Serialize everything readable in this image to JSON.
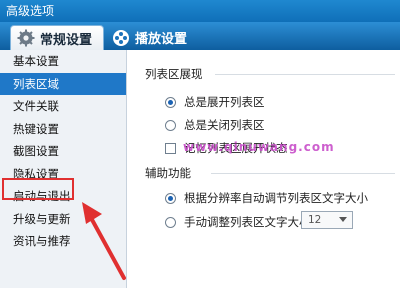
{
  "window": {
    "title": "高级选项"
  },
  "tabs": [
    {
      "label": "常规设置",
      "icon": "gear-icon",
      "active": true
    },
    {
      "label": "播放设置",
      "icon": "film-reel-icon",
      "active": false
    }
  ],
  "sidebar": {
    "items": [
      {
        "label": "基本设置"
      },
      {
        "label": "列表区域"
      },
      {
        "label": "文件关联"
      },
      {
        "label": "热键设置"
      },
      {
        "label": "截图设置"
      },
      {
        "label": "隐私设置"
      },
      {
        "label": "启动与退出"
      },
      {
        "label": "升级与更新"
      },
      {
        "label": "资讯与推荐"
      }
    ],
    "selected_index": 1,
    "highlighted_index": 6
  },
  "panel": {
    "expand_group": {
      "title": "列表区展现",
      "options": [
        {
          "label": "总是展开列表区",
          "checked": true
        },
        {
          "label": "总是关闭列表区",
          "checked": false
        },
        {
          "label": "记忆列表区展开状态",
          "checked": false
        }
      ]
    },
    "assist_group": {
      "title": "辅助功能",
      "options": [
        {
          "label": "根据分辨率自动调节列表区文字大小",
          "checked": true
        },
        {
          "label": "手动调整列表区文字大小",
          "checked": false
        }
      ],
      "font_size_select": {
        "value": "12"
      }
    }
  },
  "watermark": {
    "text": "www.qinuwang.com"
  },
  "colors": {
    "accent": "#1f78c8",
    "highlight_box": "#e03030",
    "arrow": "#e03030"
  }
}
